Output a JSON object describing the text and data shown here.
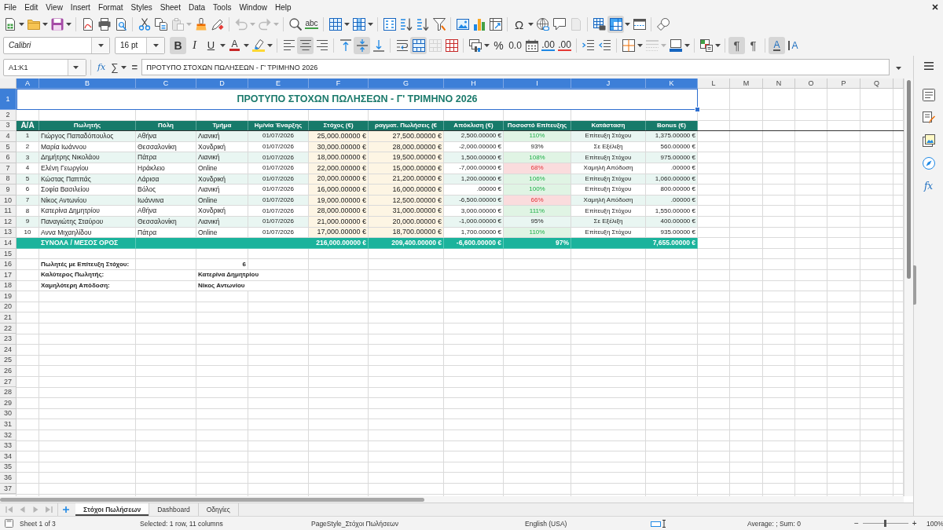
{
  "menu_bar": {
    "items": [
      "File",
      "Edit",
      "View",
      "Insert",
      "Format",
      "Styles",
      "Sheet",
      "Data",
      "Tools",
      "Window",
      "Help"
    ]
  },
  "standard_toolbar": {
    "groups": [
      {
        "items": [
          {
            "kind": "new",
            "dropdown": true,
            "on": false,
            "disabled": false
          },
          {
            "kind": "open",
            "dropdown": true,
            "on": false,
            "disabled": false
          },
          {
            "kind": "save",
            "dropdown": true,
            "on": false,
            "disabled": false
          }
        ]
      },
      {
        "items": [
          {
            "kind": "pdf",
            "dropdown": false,
            "on": false,
            "disabled": false
          },
          {
            "kind": "print",
            "dropdown": false,
            "on": false,
            "disabled": false
          },
          {
            "kind": "preview",
            "dropdown": false,
            "on": false,
            "disabled": false
          }
        ]
      },
      {
        "items": [
          {
            "kind": "cut",
            "dropdown": false,
            "on": false,
            "disabled": false
          },
          {
            "kind": "copy",
            "dropdown": false,
            "on": false,
            "disabled": false
          },
          {
            "kind": "paste",
            "dropdown": true,
            "on": false,
            "disabled": true
          },
          {
            "kind": "brush",
            "dropdown": false,
            "on": false,
            "disabled": false
          },
          {
            "kind": "clear",
            "dropdown": false,
            "on": false,
            "disabled": false
          }
        ]
      },
      {
        "items": [
          {
            "kind": "undo",
            "dropdown": true,
            "on": false,
            "disabled": true
          },
          {
            "kind": "redo",
            "dropdown": true,
            "on": false,
            "disabled": true
          }
        ]
      },
      {
        "items": [
          {
            "kind": "find",
            "dropdown": false,
            "on": false,
            "disabled": false
          },
          {
            "kind": "spell",
            "glyph": "abc",
            "dropdown": false,
            "on": false,
            "disabled": false
          }
        ]
      },
      {
        "items": [
          {
            "kind": "rows",
            "dropdown": true,
            "on": false,
            "disabled": false
          },
          {
            "kind": "columns",
            "dropdown": true,
            "on": false,
            "disabled": false
          }
        ]
      },
      {
        "items": [
          {
            "kind": "sort",
            "dropdown": false,
            "on": false,
            "disabled": false
          },
          {
            "kind": "sortup",
            "dropdown": false,
            "on": false,
            "disabled": false
          },
          {
            "kind": "sortdown",
            "dropdown": false,
            "on": false,
            "disabled": false
          },
          {
            "kind": "filter",
            "dropdown": false,
            "on": false,
            "disabled": false
          }
        ]
      },
      {
        "items": [
          {
            "kind": "image",
            "dropdown": false,
            "on": false,
            "disabled": false
          },
          {
            "kind": "chart",
            "dropdown": false,
            "on": false,
            "disabled": false
          },
          {
            "kind": "pivot",
            "dropdown": false,
            "on": false,
            "disabled": false
          }
        ]
      },
      {
        "items": [
          {
            "kind": "symbol",
            "glyph": "Ω",
            "dropdown": true,
            "on": false,
            "disabled": false
          },
          {
            "kind": "link",
            "dropdown": false,
            "on": false,
            "disabled": false
          },
          {
            "kind": "comment",
            "dropdown": false,
            "on": false,
            "disabled": false
          },
          {
            "kind": "header",
            "dropdown": false,
            "on": false,
            "disabled": true
          }
        ]
      },
      {
        "items": [
          {
            "kind": "printarea",
            "dropdown": false,
            "on": false,
            "disabled": false
          },
          {
            "kind": "freeze",
            "dropdown": true,
            "on": true,
            "disabled": false
          },
          {
            "kind": "split",
            "dropdown": false,
            "on": false,
            "disabled": false
          }
        ]
      },
      {
        "items": [
          {
            "kind": "draw",
            "dropdown": false,
            "on": false,
            "disabled": false
          }
        ]
      }
    ]
  },
  "formatting_toolbar": {
    "font_name": "Calibri",
    "font_size": "16 pt",
    "groups": [
      {
        "items": [
          {
            "kind": "bold",
            "glyph": "B",
            "dropdown": false,
            "on": true,
            "disabled": false
          },
          {
            "kind": "italic",
            "glyph": "I",
            "dropdown": false,
            "on": false,
            "disabled": false
          },
          {
            "kind": "underline",
            "glyph": "U",
            "dropdown": true,
            "on": false,
            "disabled": false
          },
          {
            "kind": "color",
            "glyph": "A",
            "dropdown": true,
            "on": false,
            "disabled": false
          },
          {
            "kind": "highlight",
            "dropdown": true,
            "on": false,
            "disabled": false
          }
        ]
      },
      {
        "items": [
          {
            "kind": "left",
            "dropdown": false,
            "on": false,
            "disabled": false
          },
          {
            "kind": "center",
            "dropdown": false,
            "on": true,
            "disabled": false
          },
          {
            "kind": "right",
            "dropdown": false,
            "on": false,
            "disabled": false
          }
        ]
      },
      {
        "items": [
          {
            "kind": "top",
            "dropdown": false,
            "on": false,
            "disabled": false
          },
          {
            "kind": "middle",
            "dropdown": false,
            "on": true,
            "disabled": false
          },
          {
            "kind": "bottom",
            "dropdown": false,
            "on": false,
            "disabled": false
          }
        ]
      },
      {
        "items": [
          {
            "kind": "wrap",
            "dropdown": false,
            "on": false,
            "disabled": false
          },
          {
            "kind": "mergecenter",
            "dropdown": false,
            "on": true,
            "disabled": false
          },
          {
            "kind": "merge",
            "dropdown": false,
            "on": false,
            "disabled": true
          },
          {
            "kind": "unmerge",
            "dropdown": false,
            "on": false,
            "disabled": false
          }
        ]
      },
      {
        "items": [
          {
            "kind": "currency",
            "dropdown": true,
            "on": false,
            "disabled": false
          },
          {
            "kind": "percent",
            "glyph": "%",
            "dropdown": false,
            "on": false,
            "disabled": false
          },
          {
            "kind": "number",
            "glyph": "0.0",
            "dropdown": false,
            "on": false,
            "disabled": false
          },
          {
            "kind": "date",
            "dropdown": false,
            "on": false,
            "disabled": false
          },
          {
            "kind": "adddecimal",
            "glyph": ".00",
            "dropdown": false,
            "on": false,
            "disabled": false
          },
          {
            "kind": "deldecimal",
            "glyph": ".00",
            "dropdown": false,
            "on": false,
            "disabled": false
          }
        ]
      },
      {
        "items": [
          {
            "kind": "indent",
            "dropdown": false,
            "on": false,
            "disabled": false
          },
          {
            "kind": "outdent",
            "dropdown": false,
            "on": false,
            "disabled": false
          }
        ]
      },
      {
        "items": [
          {
            "kind": "borders",
            "dropdown": true,
            "on": false,
            "disabled": false
          },
          {
            "kind": "borderstyle",
            "dropdown": true,
            "on": false,
            "disabled": true
          },
          {
            "kind": "bordercolor",
            "dropdown": true,
            "on": false,
            "disabled": false
          }
        ]
      },
      {
        "items": [
          {
            "kind": "conditional",
            "dropdown": true,
            "on": false,
            "disabled": false
          }
        ]
      },
      {
        "items": [
          {
            "kind": "ltr",
            "glyph": "¶",
            "dropdown": false,
            "on": true,
            "disabled": false
          },
          {
            "kind": "rtl",
            "glyph": "¶",
            "dropdown": false,
            "on": false,
            "disabled": false
          }
        ]
      },
      {
        "items": [
          {
            "kind": "horizontal",
            "glyph": "A",
            "dropdown": false,
            "on": true,
            "disabled": false
          },
          {
            "kind": "vertical",
            "glyph": "A",
            "dropdown": false,
            "on": false,
            "disabled": false
          }
        ]
      }
    ]
  },
  "formula_bar": {
    "name_box": "A1:K1",
    "function_wizard": "fx",
    "sum": "∑",
    "formula": "=",
    "content": "ΠΡΟΤΥΠΟ ΣΤΟΧΩΝ ΠΩΛΗΣΕΩΝ - Γ' ΤΡΙΜΗΝΟ 2026"
  },
  "sheet": {
    "column_headers": [
      {
        "label": "A",
        "selected": true
      },
      {
        "label": "B",
        "selected": true
      },
      {
        "label": "C",
        "selected": true
      },
      {
        "label": "D",
        "selected": true
      },
      {
        "label": "E",
        "selected": true
      },
      {
        "label": "F",
        "selected": true
      },
      {
        "label": "G",
        "selected": true
      },
      {
        "label": "H",
        "selected": true
      },
      {
        "label": "I",
        "selected": true
      },
      {
        "label": "J",
        "selected": true
      },
      {
        "label": "K",
        "selected": true
      },
      {
        "label": "L",
        "selected": false
      },
      {
        "label": "M",
        "selected": false
      },
      {
        "label": "N",
        "selected": false
      },
      {
        "label": "O",
        "selected": false
      },
      {
        "label": "P",
        "selected": false
      },
      {
        "label": "Q",
        "selected": false
      }
    ],
    "row_headers": [
      {
        "label": "1",
        "selected": true
      },
      {
        "label": "2",
        "selected": false
      },
      {
        "label": "3",
        "selected": false
      },
      {
        "label": "4",
        "selected": false
      },
      {
        "label": "5",
        "selected": false
      },
      {
        "label": "6",
        "selected": false
      },
      {
        "label": "7",
        "selected": false
      },
      {
        "label": "8",
        "selected": false
      },
      {
        "label": "9",
        "selected": false
      },
      {
        "label": "10",
        "selected": false
      },
      {
        "label": "11",
        "selected": false
      },
      {
        "label": "12",
        "selected": false
      },
      {
        "label": "13",
        "selected": false
      },
      {
        "label": "14",
        "selected": false
      },
      {
        "label": "15",
        "selected": false
      },
      {
        "label": "16",
        "selected": false
      },
      {
        "label": "17",
        "selected": false
      },
      {
        "label": "18",
        "selected": false
      },
      {
        "label": "19",
        "selected": false
      },
      {
        "label": "20",
        "selected": false
      },
      {
        "label": "21",
        "selected": false
      },
      {
        "label": "22",
        "selected": false
      },
      {
        "label": "23",
        "selected": false
      },
      {
        "label": "24",
        "selected": false
      },
      {
        "label": "25",
        "selected": false
      },
      {
        "label": "26",
        "selected": false
      },
      {
        "label": "27",
        "selected": false
      },
      {
        "label": "28",
        "selected": false
      },
      {
        "label": "29",
        "selected": false
      },
      {
        "label": "30",
        "selected": false
      },
      {
        "label": "31",
        "selected": false
      },
      {
        "label": "32",
        "selected": false
      },
      {
        "label": "33",
        "selected": false
      },
      {
        "label": "34",
        "selected": false
      },
      {
        "label": "35",
        "selected": false
      },
      {
        "label": "36",
        "selected": false
      },
      {
        "label": "37",
        "selected": false
      }
    ],
    "title": {
      "text": "ΠΡΟΤΥΠΟ ΣΤΟΧΩΝ ΠΩΛΗΣΕΩΝ - Γ' ΤΡΙΜΗΝΟ 2026",
      "selected": true
    },
    "frozen": true,
    "columns": [
      {
        "label": "Α/Α",
        "kind": "index"
      },
      {
        "label": "Πωλητής",
        "kind": "text"
      },
      {
        "label": "Πόλη",
        "kind": "text"
      },
      {
        "label": "Τμήμα",
        "kind": "text"
      },
      {
        "label": "Ημ/νία Έναρξης",
        "kind": "date"
      },
      {
        "label": "Στόχος (€)",
        "kind": "amount"
      },
      {
        "label": "ραγματ. Πωλήσεις (€",
        "kind": "amount"
      },
      {
        "label": "Απόκλιση (€)",
        "kind": "money"
      },
      {
        "label": "Ποσοστό Επίτευξης",
        "kind": "percent"
      },
      {
        "label": "Κατάσταση",
        "kind": "status"
      },
      {
        "label": "Bonus (€)",
        "kind": "money"
      }
    ],
    "rows": [
      {
        "number": "1",
        "seller": "Γιώργος Παπαδόπουλος",
        "city": "Αθήνα",
        "department": "Λιανική",
        "start_date": "01/07/2026",
        "target": "25,000.00000 €",
        "actual": "27,500.00000 €",
        "deviation": "2,500.00000 €",
        "achievement": "110%",
        "status": "Επίτευξη Στόχου",
        "bonus": "1,375.00000 €",
        "goal_reached": true,
        "low_performance": false
      },
      {
        "number": "2",
        "seller": "Μαρία Ιωάννου",
        "city": "Θεσσαλονίκη",
        "department": "Χονδρική",
        "start_date": "01/07/2026",
        "target": "30,000.00000 €",
        "actual": "28,000.00000 €",
        "deviation": "-2,000.00000 €",
        "achievement": "93%",
        "status": "Σε Εξέλιξη",
        "bonus": "560.00000 €",
        "goal_reached": false,
        "low_performance": false
      },
      {
        "number": "3",
        "seller": "Δημήτρης Νικολάου",
        "city": "Πάτρα",
        "department": "Λιανική",
        "start_date": "01/07/2026",
        "target": "18,000.00000 €",
        "actual": "19,500.00000 €",
        "deviation": "1,500.00000 €",
        "achievement": "108%",
        "status": "Επίτευξη Στόχου",
        "bonus": "975.00000 €",
        "goal_reached": true,
        "low_performance": false
      },
      {
        "number": "4",
        "seller": "Ελένη Γεωργίου",
        "city": "Ηράκλειο",
        "department": "Online",
        "start_date": "01/07/2026",
        "target": "22,000.00000 €",
        "actual": "15,000.00000 €",
        "deviation": "-7,000.00000 €",
        "achievement": "68%",
        "status": "Χαμηλή Απόδοση",
        "bonus": ".00000 €",
        "goal_reached": false,
        "low_performance": true
      },
      {
        "number": "5",
        "seller": "Κώστας Παππάς",
        "city": "Λάρισα",
        "department": "Χονδρική",
        "start_date": "01/07/2026",
        "target": "20,000.00000 €",
        "actual": "21,200.00000 €",
        "deviation": "1,200.00000 €",
        "achievement": "106%",
        "status": "Επίτευξη Στόχου",
        "bonus": "1,060.00000 €",
        "goal_reached": true,
        "low_performance": false
      },
      {
        "number": "6",
        "seller": "Σοφία Βασιλείου",
        "city": "Βόλος",
        "department": "Λιανική",
        "start_date": "01/07/2026",
        "target": "16,000.00000 €",
        "actual": "16,000.00000 €",
        "deviation": ".00000 €",
        "achievement": "100%",
        "status": "Επίτευξη Στόχου",
        "bonus": "800.00000 €",
        "goal_reached": true,
        "low_performance": false
      },
      {
        "number": "7",
        "seller": "Νίκος Αντωνίου",
        "city": "Ιωάννινα",
        "department": "Online",
        "start_date": "01/07/2026",
        "target": "19,000.00000 €",
        "actual": "12,500.00000 €",
        "deviation": "-6,500.00000 €",
        "achievement": "66%",
        "status": "Χαμηλή Απόδοση",
        "bonus": ".00000 €",
        "goal_reached": false,
        "low_performance": true
      },
      {
        "number": "8",
        "seller": "Κατερίνα Δημητρίου",
        "city": "Αθήνα",
        "department": "Χονδρική",
        "start_date": "01/07/2026",
        "target": "28,000.00000 €",
        "actual": "31,000.00000 €",
        "deviation": "3,000.00000 €",
        "achievement": "111%",
        "status": "Επίτευξη Στόχου",
        "bonus": "1,550.00000 €",
        "goal_reached": true,
        "low_performance": false
      },
      {
        "number": "9",
        "seller": "Παναγιώτης Σταύρου",
        "city": "Θεσσαλονίκη",
        "department": "Λιανική",
        "start_date": "01/07/2026",
        "target": "21,000.00000 €",
        "actual": "20,000.00000 €",
        "deviation": "-1,000.00000 €",
        "achievement": "95%",
        "status": "Σε Εξέλιξη",
        "bonus": "400.00000 €",
        "goal_reached": false,
        "low_performance": false
      },
      {
        "number": "10",
        "seller": "Αννα Μιχαηλίδου",
        "city": "Πάτρα",
        "department": "Online",
        "start_date": "01/07/2026",
        "target": "17,000.00000 €",
        "actual": "18,700.00000 €",
        "deviation": "1,700.00000 €",
        "achievement": "110%",
        "status": "Επίτευξη Στόχου",
        "bonus": "935.00000 €",
        "goal_reached": true,
        "low_performance": false
      }
    ],
    "totals": {
      "label": "ΣΥΝΟΛΑ / ΜΕΣΟΣ ΟΡΟΣ",
      "target": "216,000.00000 €",
      "actual": "209,400.00000 €",
      "deviation": "-6,600.00000 €",
      "achievement": "97%",
      "bonus": "7,655.00000 €"
    },
    "summary": [
      {
        "label": "Πωλητές με Επίτευξη Στόχου:",
        "value": "6",
        "kind": "number"
      },
      {
        "label": "Καλύτερος Πωλητής:",
        "value": "Κατερίνα Δημητρίου",
        "kind": "text"
      },
      {
        "label": "Χαμηλότερη Απόδοση:",
        "value": "Νίκος Αντωνίου",
        "kind": "text"
      }
    ]
  },
  "sheet_tabs": {
    "navigation": [
      {
        "kind": "first",
        "disabled": true
      },
      {
        "kind": "previous",
        "disabled": true
      },
      {
        "kind": "next",
        "disabled": true
      },
      {
        "kind": "last",
        "disabled": true
      }
    ],
    "tabs": [
      {
        "label": "Στόχοι Πωλήσεων",
        "selected": true
      },
      {
        "label": "Dashboard",
        "selected": false
      },
      {
        "label": "Οδηγίες",
        "selected": false
      }
    ]
  },
  "sidebar": {
    "items": [
      {
        "kind": "menu"
      },
      {
        "kind": "properties"
      },
      {
        "kind": "styles"
      },
      {
        "kind": "gallery"
      },
      {
        "kind": "navigator"
      },
      {
        "kind": "functions",
        "glyph": "fx"
      }
    ]
  },
  "status_bar": {
    "sheet": "Sheet 1 of 3",
    "selection": "Selected: 1 row, 11 columns",
    "page_style": "PageStyle_Στόχοι Πωλήσεων",
    "language": "English (USA)",
    "statistics": "Average: ; Sum: 0",
    "zoom_out": "−",
    "zoom_in": "+",
    "zoom": {
      "level": 0.5
    },
    "zoom_percent": "100%"
  }
}
